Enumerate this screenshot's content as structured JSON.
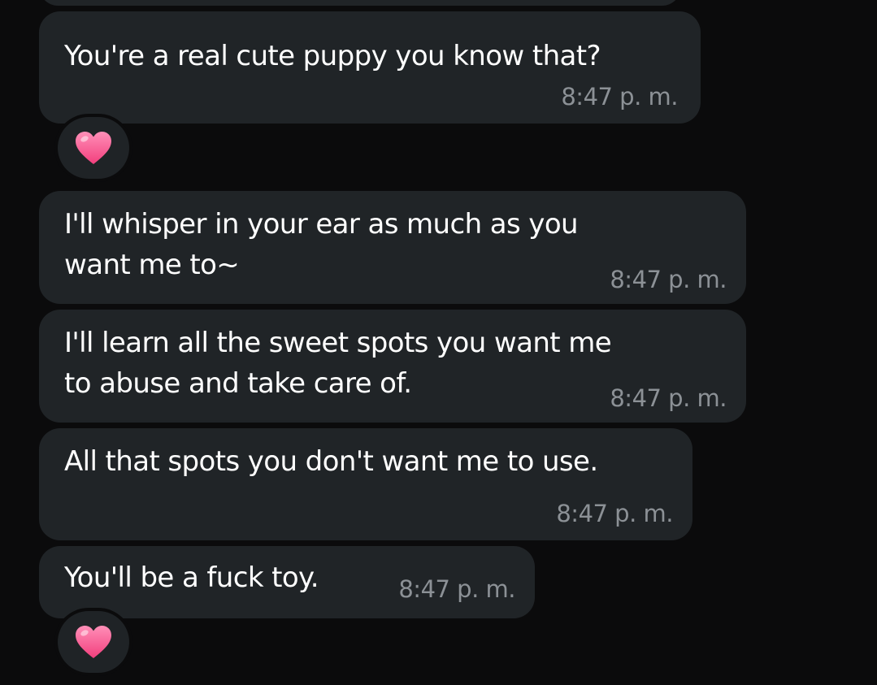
{
  "messages": [
    {
      "text": "You're a real cute puppy you know that?",
      "time": "8:47 p. m.",
      "reaction": "heart-icon"
    },
    {
      "text": "I'll whisper in your ear as much as you\nwant me to~",
      "time": "8:47 p. m."
    },
    {
      "text": "I'll learn all the sweet spots you want me\nto abuse and take care of.",
      "time": "8:47 p. m."
    },
    {
      "text": "All that spots you don't want me to use.",
      "time": "8:47 p. m."
    },
    {
      "text": "You'll be a fuck toy.",
      "time": "8:47 p. m.",
      "reaction": "heart-icon"
    }
  ],
  "colors": {
    "background": "#0b0b0c",
    "bubble": "#202427",
    "text": "#ffffff",
    "timestamp": "#8c9196",
    "reaction_heart": "#ff5c93"
  }
}
